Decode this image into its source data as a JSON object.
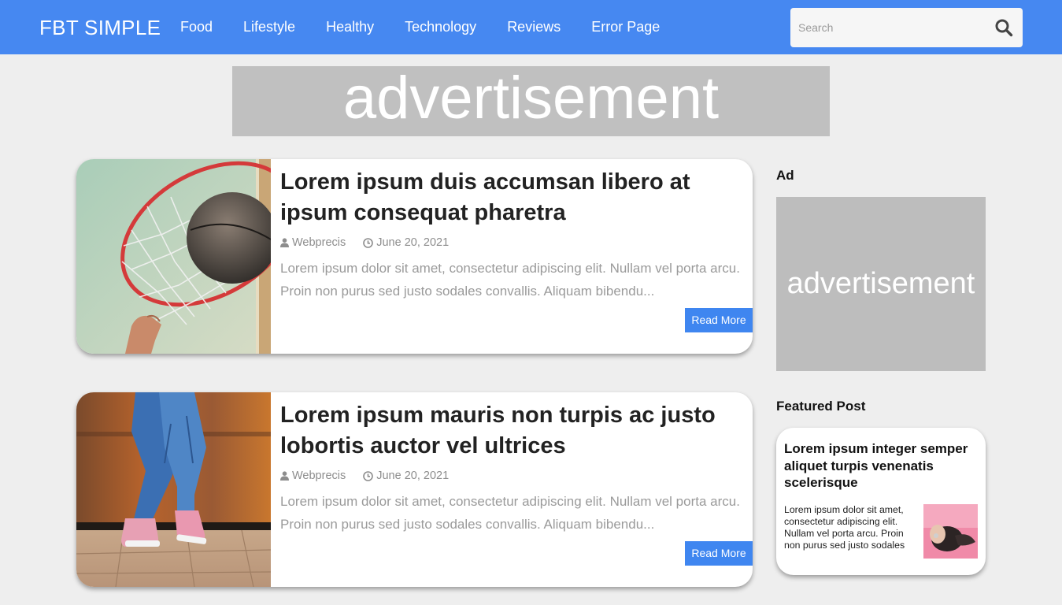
{
  "header": {
    "brand": "FBT SIMPLE",
    "nav": [
      "Food",
      "Lifestyle",
      "Healthy",
      "Technology",
      "Reviews",
      "Error Page"
    ],
    "search_placeholder": "Search",
    "accent_color": "#4688f1"
  },
  "top_ad": {
    "text": "advertisement"
  },
  "posts": [
    {
      "title": "Lorem ipsum duis accumsan libero at ipsum consequat pharetra",
      "author": "Webprecis",
      "date": "June 20, 2021",
      "excerpt": "Lorem ipsum dolor sit amet, consectetur adipiscing elit. Nullam vel porta arcu. Proin non purus sed justo sodales convallis. Aliquam bibendu...",
      "read_more": "Read More",
      "image": "basketball-hoop"
    },
    {
      "title": "Lorem ipsum mauris non turpis ac justo lobortis auctor vel ultrices",
      "author": "Webprecis",
      "date": "June 20, 2021",
      "excerpt": "Lorem ipsum dolor sit amet, consectetur adipiscing elit. Nullam vel porta arcu. Proin non purus sed justo sodales convallis. Aliquam bibendu...",
      "read_more": "Read More",
      "image": "jeans-sneakers"
    }
  ],
  "sidebar": {
    "ad_heading": "Ad",
    "ad_text": "advertisement",
    "featured_heading": "Featured Post",
    "featured": {
      "title": "Lorem ipsum integer semper aliquet turpis venenatis scelerisque",
      "text": "Lorem ipsum dolor sit amet, consectetur adipiscing elit. Nullam vel porta arcu. Proin non purus sed justo sodales",
      "image": "woman-pink-background"
    }
  },
  "icons": {
    "search": "search-icon",
    "author": "user-icon",
    "date": "clock-icon"
  }
}
